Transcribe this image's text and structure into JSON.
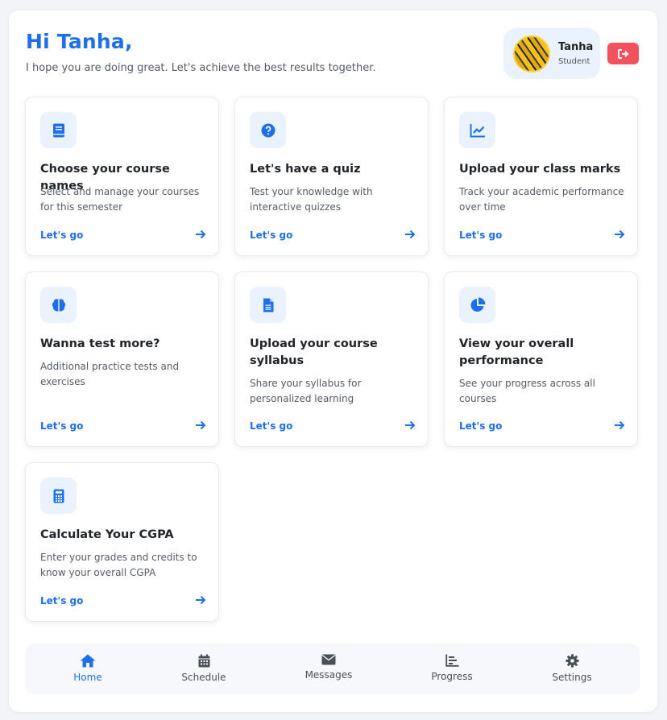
{
  "header": {
    "greeting": "Hi Tanha,",
    "subtitle": "I hope you are doing great. Let's achieve the best results together."
  },
  "profile": {
    "name": "Tanha",
    "role": "Student"
  },
  "cards": [
    {
      "icon": "book-icon",
      "title": "Choose your course names",
      "description": "Select and manage your courses for this semester",
      "action": "Let's go"
    },
    {
      "icon": "question-circle-icon",
      "title": "Let's have a quiz",
      "description": "Test your knowledge with interactive quizzes",
      "action": "Let's go"
    },
    {
      "icon": "line-chart-icon",
      "title": "Upload your class marks",
      "description": "Track your academic performance over time",
      "action": "Let's go"
    },
    {
      "icon": "brain-icon",
      "title": "Wanna test more?",
      "description": "Additional practice tests and exercises",
      "action": "Let's go"
    },
    {
      "icon": "file-document-icon",
      "title": "Upload your course syllabus",
      "description": "Share your syllabus for personalized learning",
      "action": "Let's go"
    },
    {
      "icon": "pie-chart-icon",
      "title": "View your overall performance",
      "description": "See your progress across all courses",
      "action": "Let's go"
    },
    {
      "icon": "calculator-icon",
      "title": "Calculate Your CGPA",
      "description": "Enter your grades and credits to know your overall CGPA",
      "action": "Let's go"
    }
  ],
  "nav": [
    {
      "icon": "home-icon",
      "label": "Home",
      "active": true
    },
    {
      "icon": "calendar-icon",
      "label": "Schedule",
      "active": false
    },
    {
      "icon": "envelope-icon",
      "label": "Messages",
      "active": false
    },
    {
      "icon": "bar-chart-icon",
      "label": "Progress",
      "active": false
    },
    {
      "icon": "gear-icon",
      "label": "Settings",
      "active": false
    }
  ],
  "colors": {
    "accent": "#1f6feb",
    "logout": "#f1525e",
    "icon_bg": "#eaf2fd"
  }
}
